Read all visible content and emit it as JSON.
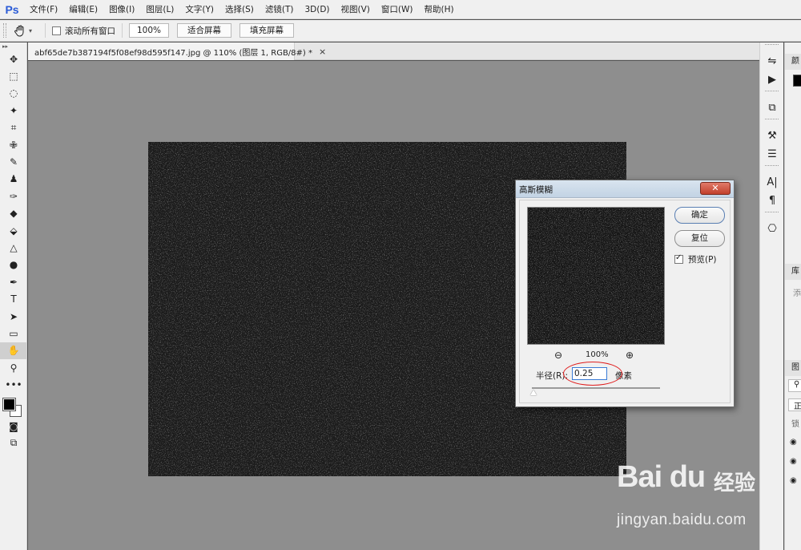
{
  "app": {
    "logo": "Ps"
  },
  "menu": [
    "文件(F)",
    "编辑(E)",
    "图像(I)",
    "图层(L)",
    "文字(Y)",
    "选择(S)",
    "滤镜(T)",
    "3D(D)",
    "视图(V)",
    "窗口(W)",
    "帮助(H)"
  ],
  "options": {
    "scroll_all_windows": "滚动所有窗口",
    "zoom_value": "100%",
    "fit_screen": "适合屏幕",
    "fill_screen": "填充屏幕"
  },
  "document": {
    "tab_title": "abf65de7b387194f5f08ef98d595f147.jpg @ 110% (图层 1, RGB/8#) *",
    "close_glyph": "×"
  },
  "toolbox": {
    "tools": [
      "✥",
      "⬚",
      "◌",
      "✦",
      "⌗",
      "✙",
      "✎",
      "♟",
      "✑",
      "◆",
      "⬙",
      "△",
      "●",
      "✒",
      "T",
      "➤",
      "▭",
      "✋",
      "⚲",
      "•••"
    ],
    "active_tool": "hand"
  },
  "right_dock_icons": [
    "⇋",
    "▶",
    "⧉",
    "⚒",
    "☰",
    "A|",
    "¶",
    "⎔"
  ],
  "right_panel": {
    "tab1": "颜",
    "tab2": "库",
    "tab3": "图",
    "extra1": "添",
    "extra2": "正",
    "extra3": "锁"
  },
  "dialog": {
    "title": "高斯模糊",
    "close_glyph": "✕",
    "ok": "确定",
    "reset": "复位",
    "preview_label": "预览(P)",
    "preview_checked": true,
    "zoom_percent": "100%",
    "radius_label": "半径(R):",
    "radius_value": "0.25",
    "radius_unit": "像素"
  },
  "watermark": {
    "logo": "Bai du",
    "suffix": "经验",
    "url": "jingyan.baidu.com"
  }
}
